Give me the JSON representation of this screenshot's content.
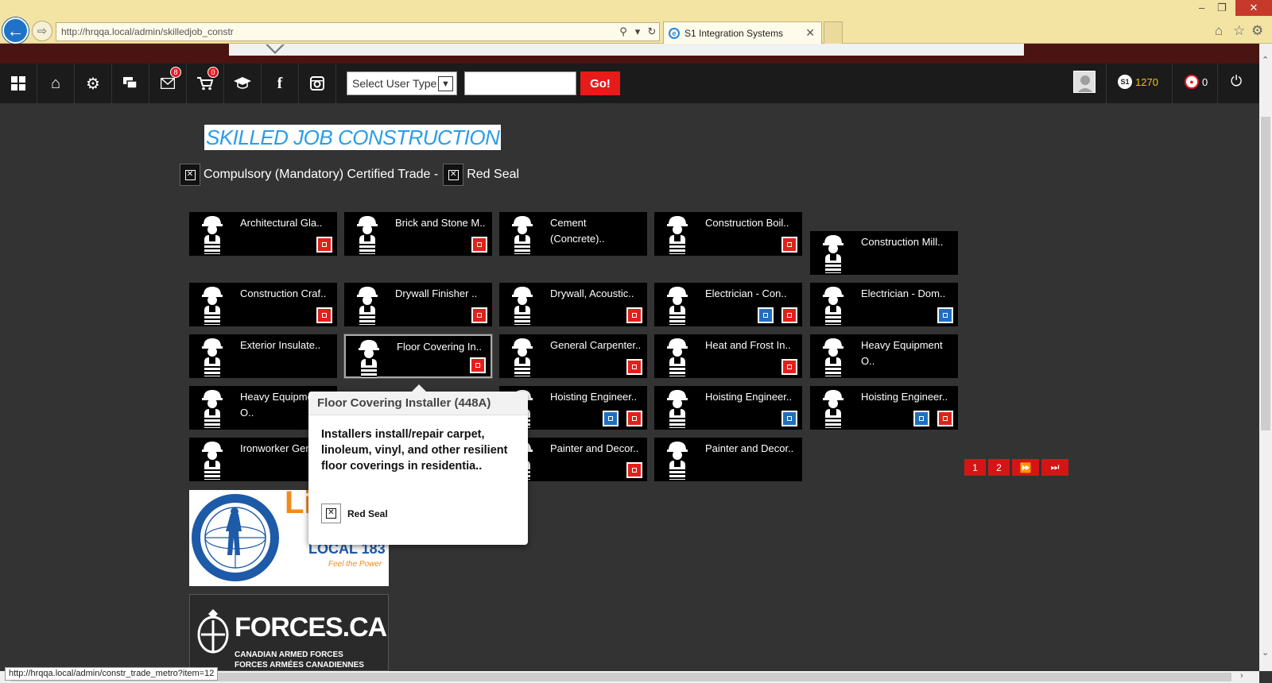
{
  "browser": {
    "url": "http://hrqqa.local/admin/skilledjob_constr",
    "tab_title": "S1 Integration Systems",
    "status_url": "http://hrqqa.local/admin/constr_trade_metro?item=12"
  },
  "toolbar": {
    "mail_badge": "8",
    "cart_badge": "0",
    "user_type_label": "Select User Type",
    "search_value": "",
    "go_label": "Go!",
    "points": "1270",
    "cart_count": "0"
  },
  "page": {
    "title": "SKILLED JOB CONSTRUCTION",
    "legend_compulsory": "Compulsory (Mandatory) Certified Trade -",
    "legend_redseal": "Red Seal"
  },
  "tiles": [
    {
      "name": "Architectural Gla..",
      "markers": [
        "red"
      ]
    },
    {
      "name": "Brick and Stone M..",
      "markers": [
        "red"
      ]
    },
    {
      "name": "Cement (Concrete)..",
      "markers": []
    },
    {
      "name": "Construction Boil..",
      "markers": [
        "red"
      ]
    },
    {
      "name": "Construction Mill..",
      "markers": []
    },
    {
      "name": "Construction Craf..",
      "markers": [
        "red"
      ]
    },
    {
      "name": "Drywall Finisher ..",
      "markers": [
        "red"
      ]
    },
    {
      "name": "Drywall, Acoustic..",
      "markers": [
        "red"
      ]
    },
    {
      "name": "Electrician - Con..",
      "markers": [
        "blue",
        "red"
      ]
    },
    {
      "name": "Electrician - Dom..",
      "markers": [
        "blue"
      ]
    },
    {
      "name": "Exterior Insulate..",
      "markers": []
    },
    {
      "name": "Floor Covering In..",
      "markers": [
        "red"
      ]
    },
    {
      "name": "General Carpenter..",
      "markers": [
        "red"
      ]
    },
    {
      "name": "Heat and Frost In..",
      "markers": [
        "red"
      ]
    },
    {
      "name": "Heavy Equipment O..",
      "markers": []
    },
    {
      "name": "Heavy Equipment O..",
      "markers": []
    },
    {
      "name": "Hoisting Engineer..",
      "markers": [
        "blue",
        "red"
      ]
    },
    {
      "name": "Hoisting Engineer..",
      "markers": [
        "blue"
      ]
    },
    {
      "name": "Hoisting Engineer..",
      "markers": [
        "blue",
        "red"
      ]
    },
    {
      "name": "Ironworker Gen..",
      "markers": []
    },
    {
      "name": "Painter and Decor..",
      "markers": [
        "red"
      ]
    },
    {
      "name": "Painter and Decor..",
      "markers": []
    }
  ],
  "tooltip": {
    "title": "Floor Covering Installer (448A)",
    "body": "Installers install/repair carpet, linoleum, vinyl, and other resilient floor coverings in residentia..",
    "tag": "Red Seal"
  },
  "pagination": [
    "1",
    "2"
  ],
  "logos": {
    "union_local": "LOCAL 183",
    "union_tagline": "Feel the Power",
    "union_big": "Li",
    "forces_title": "FORCES.CA",
    "forces_en": "CANADIAN ARMED FORCES",
    "forces_fr": "FORCES ARMÉES CANADIENNES"
  },
  "colors": {
    "accent_red": "#e2201a",
    "accent_blue": "#1e6fc1",
    "title_blue": "#2a9de8"
  }
}
